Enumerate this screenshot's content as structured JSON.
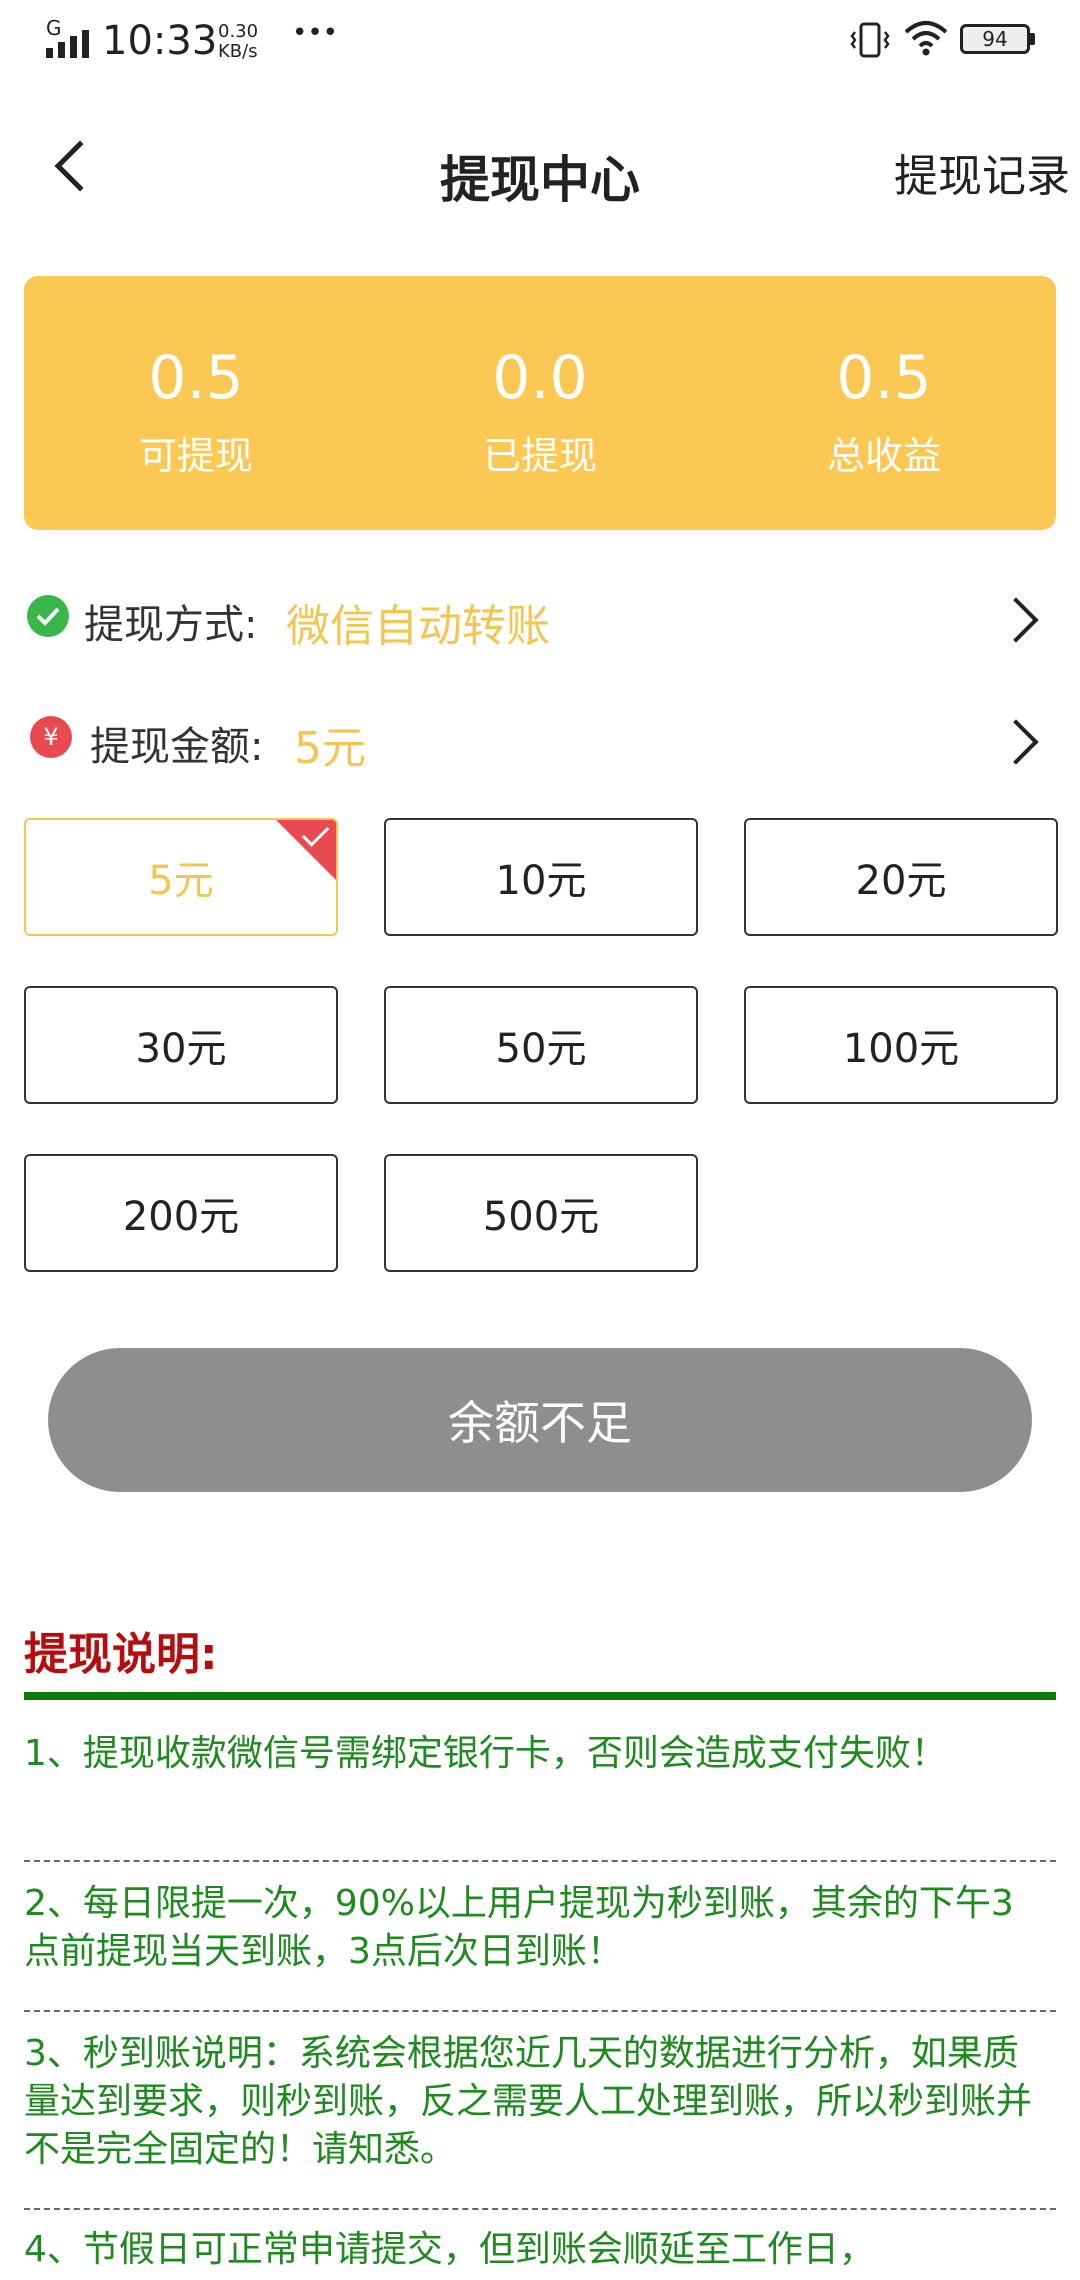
{
  "colors": {
    "accent": "#f9c74f",
    "card_bg": "#fbc853",
    "accent_text": "#f3c552",
    "wechat_green": "#39b54a",
    "yen_red": "#e94a52",
    "button_disabled": "#8e8e8e",
    "notes_title": "#b50d0d",
    "notes_bar": "#0b7a0b",
    "notes_text": "#1f8a1f"
  },
  "status_bar": {
    "network": "G",
    "time": "10:33",
    "speed_value": "0.30",
    "speed_unit": "KB/s",
    "more": "•••",
    "battery": "94"
  },
  "header": {
    "back_icon": "chevron-left-icon",
    "title": "提现中心",
    "right_link": "提现记录"
  },
  "summary": [
    {
      "value": "0.5",
      "label": "可提现"
    },
    {
      "value": "0.0",
      "label": "已提现"
    },
    {
      "value": "0.5",
      "label": "总收益"
    }
  ],
  "method_row": {
    "icon": "wechat-icon",
    "label": "提现方式:",
    "value": "微信自动转账"
  },
  "amount_row": {
    "icon": "yen-icon",
    "icon_glyph": "¥",
    "label": "提现金额:",
    "value": "5元"
  },
  "amounts": [
    {
      "label": "5元",
      "selected": true
    },
    {
      "label": "10元",
      "selected": false
    },
    {
      "label": "20元",
      "selected": false
    },
    {
      "label": "30元",
      "selected": false
    },
    {
      "label": "50元",
      "selected": false
    },
    {
      "label": "100元",
      "selected": false
    },
    {
      "label": "200元",
      "selected": false
    },
    {
      "label": "500元",
      "selected": false
    }
  ],
  "submit_label": "余额不足",
  "notes": {
    "title": "提现说明:",
    "items": [
      "1、提现收款微信号需绑定银行卡，否则会造成支付失败！",
      "2、每日限提一次，90%以上用户提现为秒到账，其余的下午3点前提现当天到账，3点后次日到账！",
      "3、秒到账说明：系统会根据您近几天的数据进行分析，如果质量达到要求，则秒到账，反之需要人工处理到账，所以秒到账并不是完全固定的！请知悉。",
      "4、节假日可正常申请提交，但到账会顺延至工作日，"
    ]
  }
}
